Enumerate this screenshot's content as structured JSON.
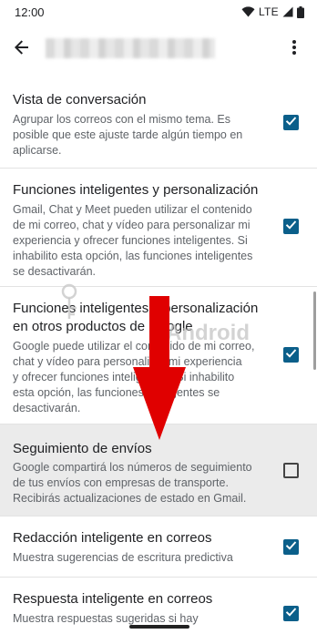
{
  "status_bar": {
    "time": "12:00",
    "network": "LTE",
    "icons": [
      "wifi-icon",
      "signal-icon",
      "battery-icon"
    ]
  },
  "app_bar": {
    "back_icon": "arrow-back-icon",
    "more_icon": "more-vert-icon"
  },
  "settings": [
    {
      "title": "Vista de conversación",
      "desc": [
        "Agrupar los correos con el mismo tema. Es",
        "posible que este ajuste tarde algún tiempo en",
        "aplicarse."
      ],
      "checked": true
    },
    {
      "title": "Funciones inteligentes y personalización",
      "desc": [
        "Gmail, Chat y Meet pueden utilizar el contenido",
        "de mi correo, chat y vídeo para personalizar mi",
        "experiencia y ofrecer funciones inteligentes. Si",
        "inhabilito esta opción, las funciones inteligentes",
        "se desactivarán."
      ],
      "checked": true
    },
    {
      "title": "Funciones inteligentes y personalización",
      "title2": "en otros productos de Google",
      "desc": [
        "Google puede utilizar el contenido de mi correo,",
        "chat y vídeo para personalizar mi experiencia",
        "y ofrecer funciones inteligentes. Si inhabilito",
        "esta opción, las funciones inteligentes se",
        "desactivarán."
      ],
      "checked": true
    },
    {
      "title": "Seguimiento de envíos",
      "desc": [
        "Google compartirá los números de seguimiento",
        "de tus envíos con empresas de transporte.",
        "Recibirás actualizaciones de estado en Gmail."
      ],
      "checked": false
    },
    {
      "title": "Redacción inteligente en correos",
      "desc": [
        "Muestra sugerencias de escritura predictiva"
      ],
      "checked": true
    },
    {
      "title": "Respuesta inteligente en correos",
      "desc": [
        "Muestra respuestas sugeridas si hay"
      ],
      "checked": true
    }
  ],
  "watermark": {
    "brand": "Android",
    "icon": "android-logo-icon"
  },
  "annotation": {
    "icon": "red-down-arrow-icon",
    "color": "#e00000"
  },
  "colors": {
    "checkbox_checked": "#0b5f8a",
    "highlight_row": "#ebebeb",
    "arrow_red": "#e00000"
  }
}
